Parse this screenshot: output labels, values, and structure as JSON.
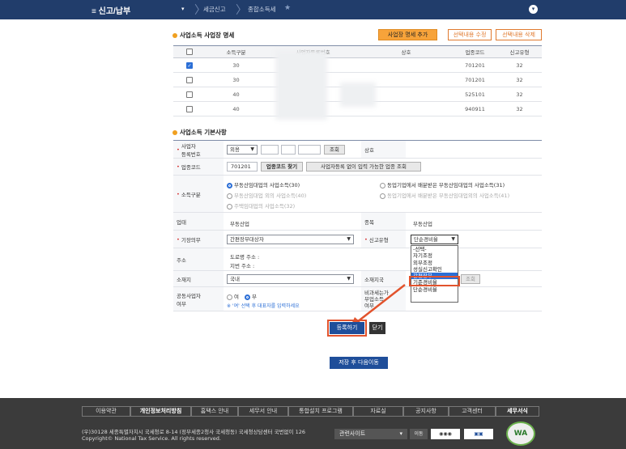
{
  "header": {
    "menu_title": "≡ 신고/납부",
    "crumbs": [
      "세금신고",
      "종합소득세"
    ]
  },
  "list": {
    "title": "사업소득 사업장 명세",
    "buttons": [
      "사업장 명세 추가",
      "선택내용 수정",
      "선택내용 삭제"
    ],
    "columns": [
      "소득구분",
      "사업자등록번호",
      "상호",
      "업종코드",
      "신고유형"
    ],
    "rows": [
      {
        "checked": true,
        "kind": "30",
        "code": "701201",
        "type": "32"
      },
      {
        "checked": false,
        "kind": "30",
        "code": "701201",
        "type": "32"
      },
      {
        "checked": false,
        "kind": "40",
        "code": "525101",
        "type": "32"
      },
      {
        "checked": false,
        "kind": "40",
        "code": "940911",
        "type": "32"
      }
    ]
  },
  "form": {
    "title": "사업소득 기본사항",
    "biz_no_label": "사업자\n등록번호",
    "biz_no_select": "외용",
    "lookup": "조회",
    "shop_label": "상호",
    "industry_label": "업종코드",
    "industry_code": "701201",
    "industry_find": "업종코드 찾기",
    "industry_nobiz": "사업자등록 없이 입력 가능한 업종 조회",
    "income_label": "소득구분",
    "income_opts": [
      "부동산임대업의 사업소득(30)",
      "부동산임대업 외의 사업소득(40)",
      "주택임대업의 사업소득(32)"
    ],
    "income_opts2": [
      "동업기업에서 배분받은 부동산임대업의 사업소득(31)",
      "동업기업에서 배분받은 부동산임대업외의 사업소득(41)"
    ],
    "biz_type_label": "업태",
    "biz_type": "부동산업",
    "item_label": "종목",
    "item": "부동산업",
    "duty_label": "기장의무",
    "duty": "간편장부대상자",
    "report_label": "신고유형",
    "report": "단순경비율",
    "addr_label": "주소",
    "road": "도로명 주소 :",
    "lot": "지번 주소 :",
    "loc_label": "소재지",
    "loc": "국내",
    "tax_office_label": "소재지국",
    "tax_office_lookup": "조회",
    "joint_label": "공동사업자\n여부",
    "joint_no": "여",
    "joint_yes": "부",
    "joint_note": "※ '여' 선택 후 대표자를 입력하세요",
    "nontax_label": "비과세는가\n부업소득\n여부",
    "dropdown": [
      "-선택-",
      "자기조정",
      "외부조정",
      "성실신고확인",
      "간편장부",
      "기준경비율",
      "단순경비율"
    ]
  },
  "actions": {
    "register": "등록하기",
    "close": "닫기",
    "save_next": "저장 후 다음이동"
  },
  "footer": {
    "links": [
      "이용약관",
      "개인정보처리방침",
      "홈택스 안내",
      "세무서 안내",
      "통합설치 프로그램",
      "자료실",
      "공지사항",
      "고객센터",
      "세무서식"
    ],
    "addr1": "(우)30128 세종특별자치시 국세청로 8-14 (정부세종2청사 국세청동) 국세청상담센터 국번없이 126",
    "addr2": "Copyright© National Tax Service. All rights reserved.",
    "site": "관련사이트",
    "go": "이동",
    "wa": "WA"
  }
}
